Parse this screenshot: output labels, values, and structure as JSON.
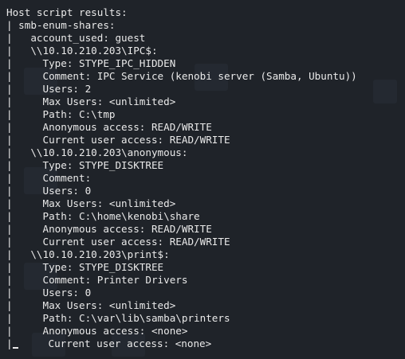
{
  "terminal": {
    "lines": [
      "Host script results:",
      "| smb-enum-shares:",
      "|   account_used: guest",
      "|   \\\\10.10.210.203\\IPC$:",
      "|     Type: STYPE_IPC_HIDDEN",
      "|     Comment: IPC Service (kenobi server (Samba, Ubuntu))",
      "|     Users: 2",
      "|     Max Users: <unlimited>",
      "|     Path: C:\\tmp",
      "|     Anonymous access: READ/WRITE",
      "|     Current user access: READ/WRITE",
      "|   \\\\10.10.210.203\\anonymous:",
      "|     Type: STYPE_DISKTREE",
      "|     Comment:",
      "|     Users: 0",
      "|     Max Users: <unlimited>",
      "|     Path: C:\\home\\kenobi\\share",
      "|     Anonymous access: READ/WRITE",
      "|     Current user access: READ/WRITE",
      "|   \\\\10.10.210.203\\print$:",
      "|     Type: STYPE_DISKTREE",
      "|     Comment: Printer Drivers",
      "|     Users: 0",
      "|     Max Users: <unlimited>",
      "|     Path: C:\\var\\lib\\samba\\printers",
      "|     Anonymous access: <none>"
    ],
    "last_line": {
      "prefix": "|",
      "text": "     Current user access: <none>"
    },
    "colors": {
      "background": "#1f2329",
      "text": "#eaeaea"
    }
  }
}
